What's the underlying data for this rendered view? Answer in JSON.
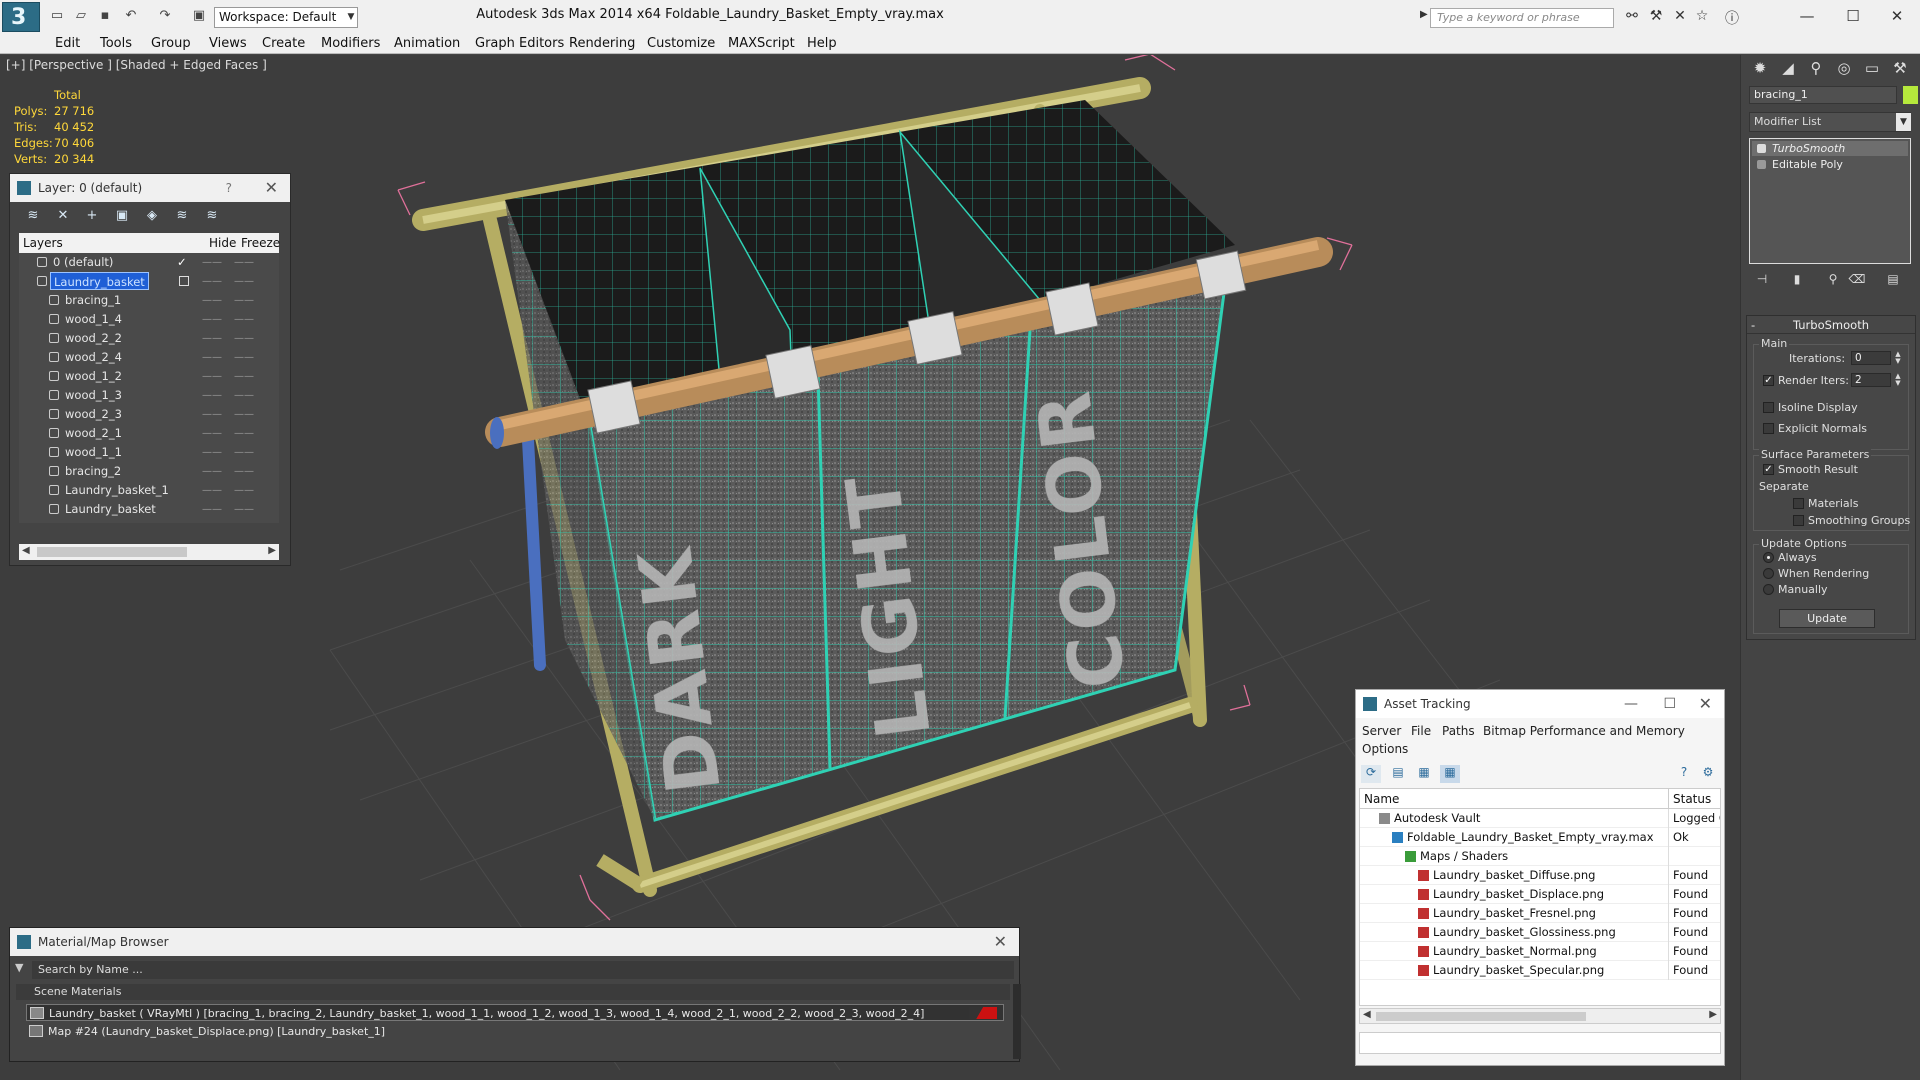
{
  "titlebar": {
    "title": "Autodesk 3ds Max  2014 x64      Foldable_Laundry_Basket_Empty_vray.max",
    "workspace": "Workspace: Default",
    "search_placeholder": "Type a keyword or phrase"
  },
  "menu": [
    "Edit",
    "Tools",
    "Group",
    "Views",
    "Create",
    "Modifiers",
    "Animation",
    "Graph Editors",
    "Rendering",
    "Customize",
    "MAXScript",
    "Help"
  ],
  "viewport": {
    "label": "[+] [Perspective ] [Shaded + Edged Faces ]",
    "stats": {
      "total_label": "Total",
      "rows": [
        {
          "k": "Polys:",
          "v": "27 716"
        },
        {
          "k": "Tris:",
          "v": "40 452"
        },
        {
          "k": "Edges:",
          "v": "70 406"
        },
        {
          "k": "Verts:",
          "v": "20 344"
        }
      ]
    },
    "basket_labels": [
      "DARK",
      "LIGHT",
      "COLOR"
    ]
  },
  "layers": {
    "title": "Layer: 0 (default)",
    "help": "?",
    "col_layers": "Layers",
    "col_hide": "Hide",
    "col_freeze": "Freeze",
    "rows": [
      {
        "name": "0 (default)",
        "level": 0,
        "check": "✓"
      },
      {
        "name": "Laundry_basket",
        "level": 0,
        "selected": true
      },
      {
        "name": "bracing_1",
        "level": 1
      },
      {
        "name": "wood_1_4",
        "level": 1
      },
      {
        "name": "wood_2_2",
        "level": 1
      },
      {
        "name": "wood_2_4",
        "level": 1
      },
      {
        "name": "wood_1_2",
        "level": 1
      },
      {
        "name": "wood_1_3",
        "level": 1
      },
      {
        "name": "wood_2_3",
        "level": 1
      },
      {
        "name": "wood_2_1",
        "level": 1
      },
      {
        "name": "wood_1_1",
        "level": 1
      },
      {
        "name": "bracing_2",
        "level": 1
      },
      {
        "name": "Laundry_basket_1",
        "level": 1
      },
      {
        "name": "Laundry_basket",
        "level": 1
      }
    ]
  },
  "command_panel": {
    "object_name": "bracing_1",
    "modifier_list": "Modifier List",
    "stack": [
      "TurboSmooth",
      "Editable Poly"
    ],
    "rollout": {
      "title": "TurboSmooth",
      "main": "Main",
      "iterations_label": "Iterations:",
      "iterations": "0",
      "render_iters_label": "Render Iters:",
      "render_iters": "2",
      "isoline": "Isoline Display",
      "explicit_normals": "Explicit Normals",
      "surface_params": "Surface Parameters",
      "smooth_result": "Smooth Result",
      "separate": "Separate",
      "materials": "Materials",
      "smoothing_groups": "Smoothing Groups",
      "update_options": "Update Options",
      "always": "Always",
      "when_rendering": "When Rendering",
      "manually": "Manually",
      "update": "Update"
    }
  },
  "material_browser": {
    "title": "Material/Map Browser",
    "search": "Search by Name ...",
    "section": "Scene Materials",
    "rows": [
      "Laundry_basket  ( VRayMtl ) [bracing_1, bracing_2, Laundry_basket_1, wood_1_1, wood_1_2, wood_1_3, wood_1_4, wood_2_1, wood_2_2, wood_2_3, wood_2_4]",
      "Map #24 (Laundry_basket_Displace.png) [Laundry_basket_1]"
    ]
  },
  "asset_tracking": {
    "title": "Asset Tracking",
    "menu": [
      "Server",
      "File",
      "Paths",
      "Bitmap Performance and Memory",
      "Options"
    ],
    "col_name": "Name",
    "col_status": "Status",
    "rows": [
      {
        "name": "Autodesk Vault",
        "status": "Logged O",
        "indent": 1
      },
      {
        "name": "Foldable_Laundry_Basket_Empty_vray.max",
        "status": "Ok",
        "indent": 2
      },
      {
        "name": "Maps / Shaders",
        "status": "",
        "indent": 3
      },
      {
        "name": "Laundry_basket_Diffuse.png",
        "status": "Found",
        "indent": 4
      },
      {
        "name": "Laundry_basket_Displace.png",
        "status": "Found",
        "indent": 4
      },
      {
        "name": "Laundry_basket_Fresnel.png",
        "status": "Found",
        "indent": 4
      },
      {
        "name": "Laundry_basket_Glossiness.png",
        "status": "Found",
        "indent": 4
      },
      {
        "name": "Laundry_basket_Normal.png",
        "status": "Found",
        "indent": 4
      },
      {
        "name": "Laundry_basket_Specular.png",
        "status": "Found",
        "indent": 4
      }
    ]
  },
  "colors": {
    "wood": "#c9c27a",
    "wire": "#2fd1b4",
    "selection": "#1f5fd6",
    "viewport_bg": "#3d3d3d"
  }
}
